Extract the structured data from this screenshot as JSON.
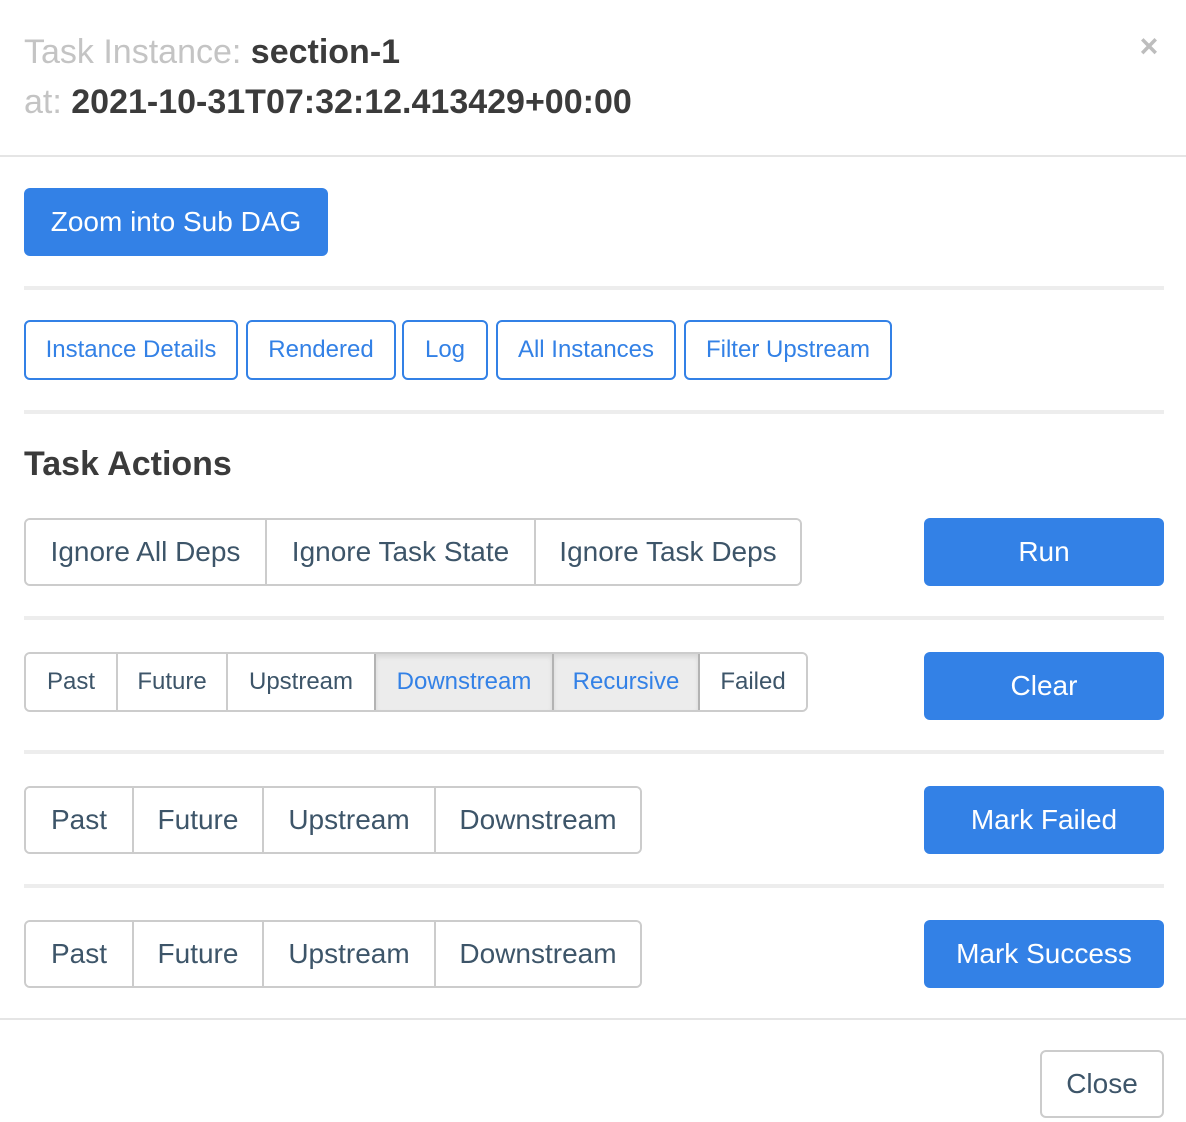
{
  "header": {
    "title_key": "Task Instance:",
    "title_value": "section-1",
    "at_key": "at:",
    "at_value": "2021-10-31T07:32:12.413429+00:00",
    "close_icon": "×"
  },
  "zoom_button": "Zoom into Sub DAG",
  "nav_buttons": {
    "instance_details": "Instance Details",
    "rendered": "Rendered",
    "log": "Log",
    "all_instances": "All Instances",
    "filter_upstream": "Filter Upstream"
  },
  "task_actions": {
    "title": "Task Actions",
    "run": {
      "options": [
        "Ignore All Deps",
        "Ignore Task State",
        "Ignore Task Deps"
      ],
      "button": "Run"
    },
    "clear": {
      "options": [
        "Past",
        "Future",
        "Upstream",
        "Downstream",
        "Recursive",
        "Failed"
      ],
      "active": [
        "Downstream",
        "Recursive"
      ],
      "button": "Clear"
    },
    "mark_failed": {
      "options": [
        "Past",
        "Future",
        "Upstream",
        "Downstream"
      ],
      "button": "Mark Failed"
    },
    "mark_success": {
      "options": [
        "Past",
        "Future",
        "Upstream",
        "Downstream"
      ],
      "button": "Mark Success"
    }
  },
  "footer": {
    "close": "Close"
  },
  "colors": {
    "primary": "#3381e6",
    "text": "#3d5569",
    "muted": "#c4c4c4"
  }
}
